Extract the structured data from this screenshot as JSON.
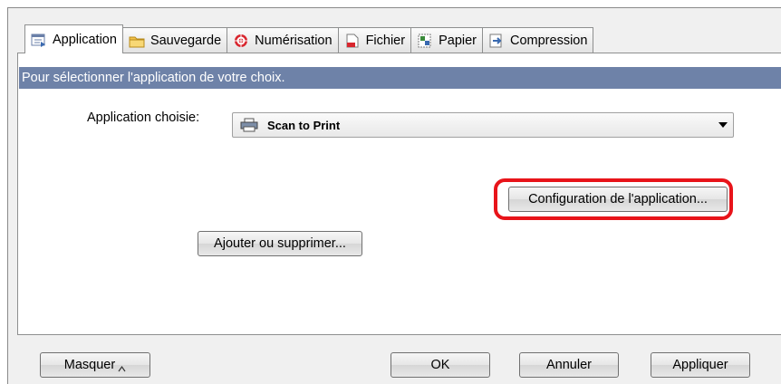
{
  "tabs": [
    {
      "label": "Application",
      "icon": "application-icon",
      "active": true
    },
    {
      "label": "Sauvegarde",
      "icon": "folder-icon"
    },
    {
      "label": "Numérisation",
      "icon": "scan-icon"
    },
    {
      "label": "Fichier",
      "icon": "file-icon"
    },
    {
      "label": "Papier",
      "icon": "paper-icon"
    },
    {
      "label": "Compression",
      "icon": "compression-icon"
    }
  ],
  "infobar": {
    "text": "Pour sélectionner l'application de votre choix."
  },
  "app_select": {
    "label": "Application choisie:",
    "value": "Scan to Print",
    "icon": "printer-icon"
  },
  "buttons": {
    "config": "Configuration de l'application...",
    "add_remove": "Ajouter ou supprimer...",
    "hide": "Masquer",
    "ok": "OK",
    "cancel": "Annuler",
    "apply": "Appliquer"
  },
  "colors": {
    "infobar": "#6e82a8",
    "highlight": "#e8141a"
  }
}
